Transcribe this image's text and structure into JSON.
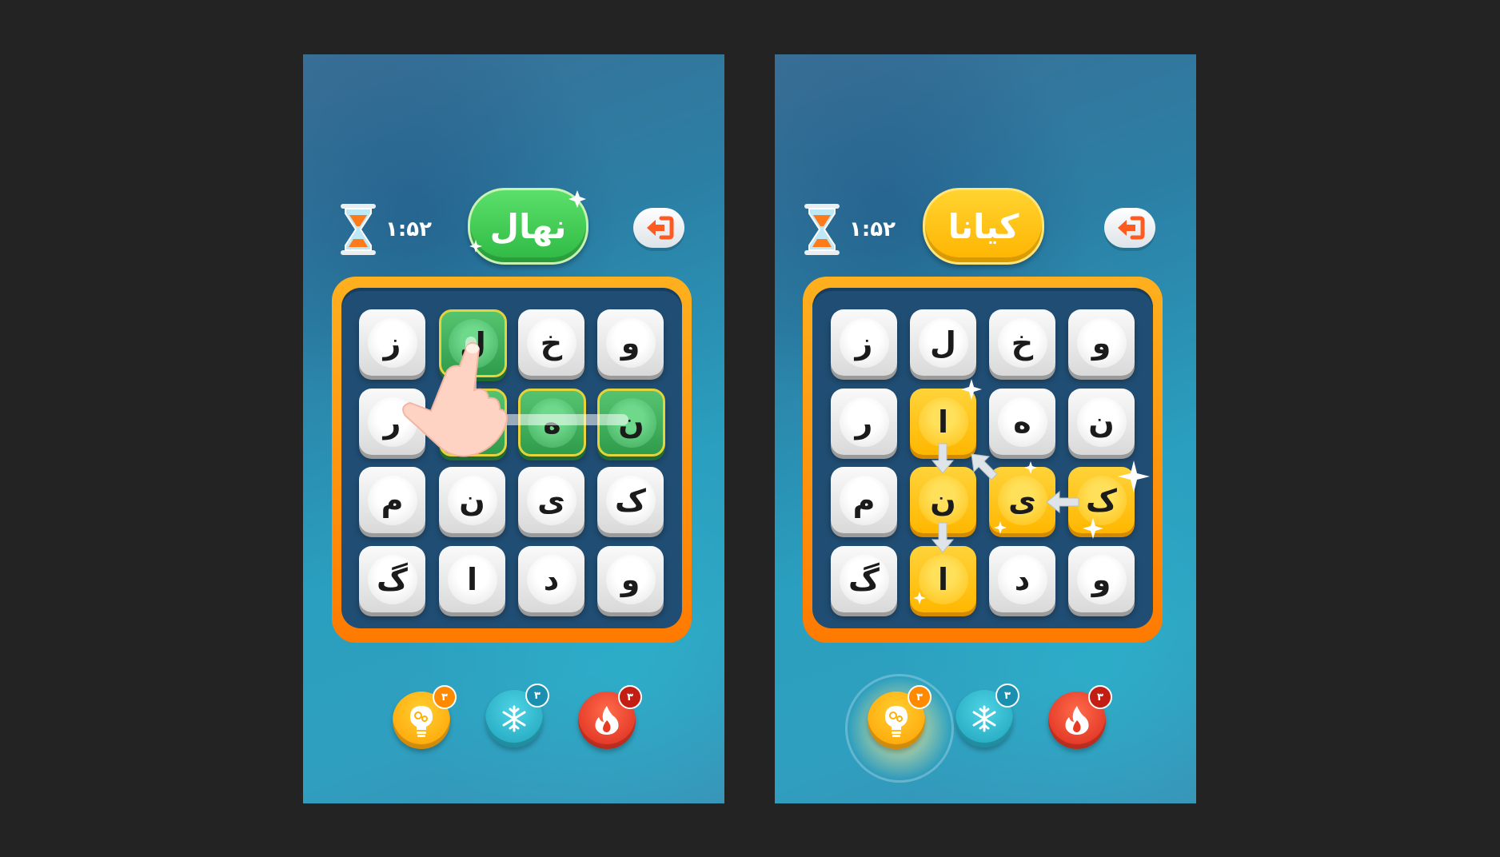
{
  "panels": [
    {
      "timer": "۱:۵۲",
      "player_name": "نهال",
      "grid": [
        [
          "و",
          "خ",
          "ل",
          "ز"
        ],
        [
          "ن",
          "ه",
          "ا",
          "ر"
        ],
        [
          "ک",
          "ی",
          "ن",
          "م"
        ],
        [
          "و",
          "د",
          "ا",
          "گ"
        ]
      ],
      "powerups": [
        {
          "name": "bulb-icon",
          "count": "۳"
        },
        {
          "name": "snowflake-icon",
          "count": "۳"
        },
        {
          "name": "fire-icon",
          "count": "۳"
        }
      ]
    },
    {
      "timer": "۱:۵۲",
      "player_name": "کیانا",
      "grid": [
        [
          "و",
          "خ",
          "ل",
          "ز"
        ],
        [
          "ن",
          "ه",
          "ا",
          "ر"
        ],
        [
          "ک",
          "ی",
          "ن",
          "م"
        ],
        [
          "و",
          "د",
          "ا",
          "گ"
        ]
      ],
      "powerups": [
        {
          "name": "bulb-icon",
          "count": "۳"
        },
        {
          "name": "snowflake-icon",
          "count": "۳"
        },
        {
          "name": "fire-icon",
          "count": "۳"
        }
      ]
    }
  ],
  "colors": {
    "green_pill": "#3cc957",
    "yellow_pill": "#ffbf10",
    "board_orange": "#ff8c00",
    "board_inner": "#204d73",
    "exit_arrow": "#ff5a1f"
  }
}
